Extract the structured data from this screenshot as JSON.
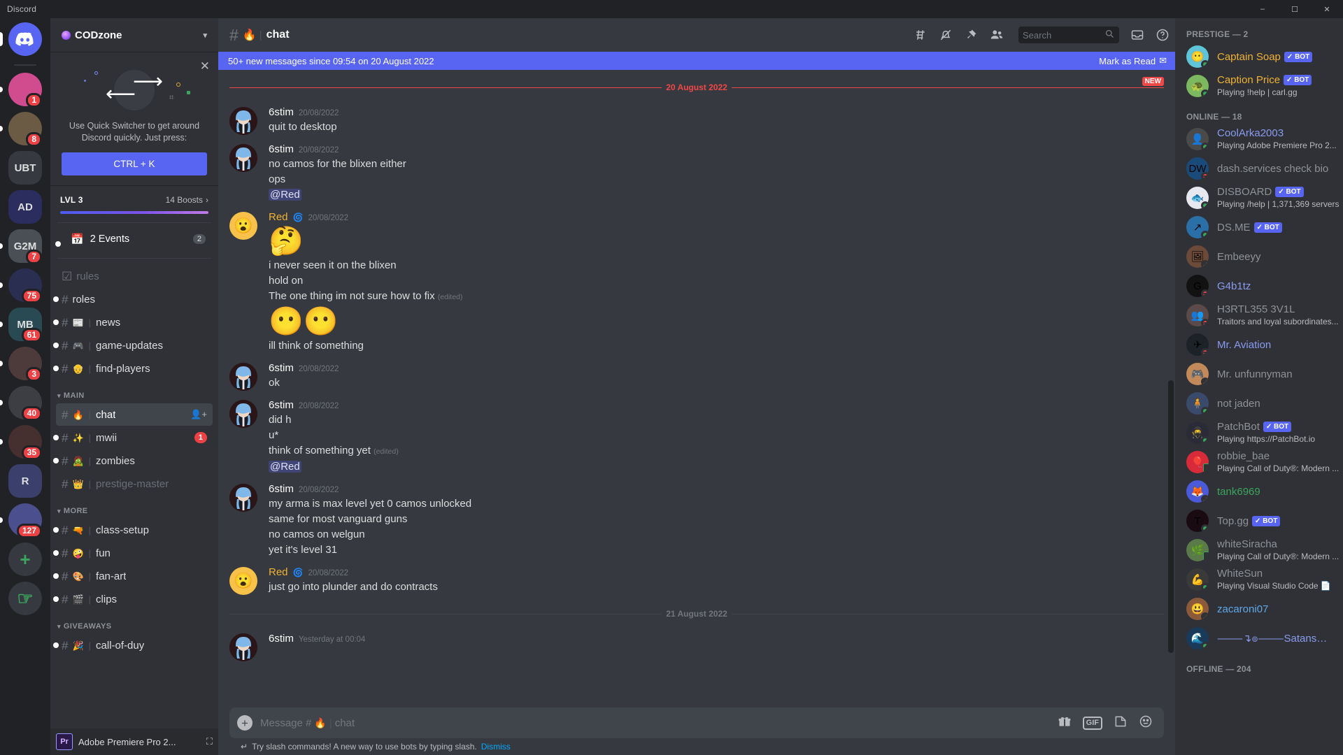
{
  "titlebar": {
    "app": "Discord",
    "minimize": "–",
    "maximize": "☐",
    "close": "✕"
  },
  "guilds": [
    {
      "name": "home",
      "label": "",
      "badge": "",
      "type": "home"
    },
    {
      "name": "guild-pink",
      "label": "",
      "badge": "1",
      "color": "#d14b8f"
    },
    {
      "name": "guild-sniper",
      "label": "",
      "badge": "8",
      "color": "#6b5a44"
    },
    {
      "name": "guild-ubt",
      "label": "UBT",
      "badge": "",
      "color": "#36393f"
    },
    {
      "name": "guild-ad",
      "label": "AD",
      "badge": "",
      "color": "#2b2d5e"
    },
    {
      "name": "guild-g2m",
      "label": "G2M",
      "badge": "7",
      "color": "#4a4f55"
    },
    {
      "name": "guild-75",
      "label": "",
      "badge": "75",
      "color": "#2a2f52"
    },
    {
      "name": "guild-mb",
      "label": "MB",
      "badge": "61",
      "color": "#294a52"
    },
    {
      "name": "guild-3",
      "label": "",
      "badge": "3",
      "color": "#4d3a3a"
    },
    {
      "name": "guild-40",
      "label": "",
      "badge": "40",
      "color": "#3d3d44"
    },
    {
      "name": "guild-35",
      "label": "",
      "badge": "35",
      "color": "#452f2f"
    },
    {
      "name": "guild-r",
      "label": "R",
      "badge": "",
      "color": "#3a3f6b"
    },
    {
      "name": "guild-127",
      "label": "",
      "badge": "127",
      "color": "#4b4f8e"
    }
  ],
  "sidebar": {
    "server_name": "CODzone",
    "quick_switcher": {
      "close": "✕",
      "text": "Use Quick Switcher to get around Discord quickly. Just press:",
      "button": "CTRL + K"
    },
    "boost": {
      "level": "LVL 3",
      "count": "14 Boosts",
      "chevron": "›"
    },
    "events": {
      "label": "2 Events",
      "badge": "2",
      "icon": "calendar-icon"
    },
    "channels": [
      {
        "name": "rules",
        "emoji": "",
        "hash": "☑",
        "muted": true,
        "unread": false,
        "dot": false
      },
      {
        "name": "roles",
        "emoji": "",
        "hash": "#",
        "muted": false,
        "unread": true,
        "dot": true
      },
      {
        "name": "news",
        "emoji": "📰",
        "hash": "#",
        "muted": false,
        "unread": true,
        "dot": true
      },
      {
        "name": "game-updates",
        "emoji": "🎮",
        "hash": "#",
        "muted": false,
        "unread": true,
        "dot": true
      },
      {
        "name": "find-players",
        "emoji": "👴",
        "hash": "#",
        "muted": false,
        "unread": true,
        "dot": true
      }
    ],
    "categories": [
      {
        "label": "MAIN",
        "channels": [
          {
            "name": "chat",
            "emoji": "🔥",
            "hash": "#",
            "active": true,
            "unread": true,
            "dot": false,
            "trailing": "add-member-icon"
          },
          {
            "name": "mwii",
            "emoji": "✨",
            "hash": "#",
            "unread": true,
            "dot": true,
            "badge": "1"
          },
          {
            "name": "zombies",
            "emoji": "🧟",
            "hash": "#",
            "unread": true,
            "dot": true
          },
          {
            "name": "prestige-master",
            "emoji": "👑",
            "hash": "#",
            "muted": true,
            "dot": false
          }
        ]
      },
      {
        "label": "MORE",
        "channels": [
          {
            "name": "class-setup",
            "emoji": "🔫",
            "hash": "#",
            "unread": true,
            "dot": true
          },
          {
            "name": "fun",
            "emoji": "🤪",
            "hash": "#",
            "unread": true,
            "dot": true
          },
          {
            "name": "fan-art",
            "emoji": "🎨",
            "hash": "#",
            "unread": true,
            "dot": true
          },
          {
            "name": "clips",
            "emoji": "🎬",
            "hash": "#",
            "unread": true,
            "dot": true
          }
        ]
      },
      {
        "label": "GIVEAWAYS",
        "channels": [
          {
            "name": "call-of-duy",
            "emoji": "🎉",
            "hash": "#",
            "unread": true,
            "dot": true
          }
        ]
      }
    ],
    "now_playing": {
      "icon": "Pr",
      "name": "Adobe Premiere Pro 2...",
      "screen_icon": "screenshare-icon"
    }
  },
  "header": {
    "hash": "#",
    "emoji": "🔥",
    "divider": "|",
    "channel": "chat",
    "icons": [
      "threads-icon",
      "notification-off-icon",
      "pin-icon",
      "members-icon"
    ],
    "search_placeholder": "Search",
    "search_icon": "search-icon",
    "inbox_icon": "inbox-icon",
    "help_icon": "help-icon"
  },
  "new_messages_bar": {
    "text": "50+ new messages since 09:54 on 20 August 2022",
    "mark_as_read": "Mark as Read",
    "mark_icon": "check-mail-icon"
  },
  "dividers": {
    "first": "20 August 2022",
    "new_tag": "NEW",
    "second": "21 August 2022"
  },
  "messages": [
    {
      "author": "6stim",
      "color": "white",
      "timestamp": "20/08/2022",
      "avatar": "6stim-avatar",
      "lines": [
        {
          "text": "quit to desktop"
        }
      ]
    },
    {
      "author": "6stim",
      "color": "white",
      "timestamp": "20/08/2022",
      "avatar": "6stim-avatar",
      "lines": [
        {
          "text": "no camos for the blixen either"
        },
        {
          "text": "ops"
        },
        {
          "text": "@Red",
          "mention": true
        }
      ]
    },
    {
      "author": "Red",
      "color": "red",
      "timestamp": "20/08/2022",
      "avatar": "red-avatar",
      "name_icon": "🌀",
      "lines": [
        {
          "emoji": "🤔",
          "big": true
        },
        {
          "text": "i never seen it on the blixen"
        },
        {
          "text": "hold on"
        },
        {
          "text": "The one thing im not sure how to fix",
          "edited": "(edited)"
        },
        {
          "emoji": "😶😶",
          "big": true
        },
        {
          "text": "ill think of something"
        }
      ]
    },
    {
      "author": "6stim",
      "color": "white",
      "timestamp": "20/08/2022",
      "avatar": "6stim-avatar",
      "lines": [
        {
          "text": "ok"
        }
      ]
    },
    {
      "author": "6stim",
      "color": "white",
      "timestamp": "20/08/2022",
      "avatar": "6stim-avatar",
      "lines": [
        {
          "text": "did h"
        },
        {
          "text": "u*"
        },
        {
          "text": "think of something yet",
          "edited": "(edited)"
        },
        {
          "text": "@Red",
          "mention": true
        }
      ]
    },
    {
      "author": "6stim",
      "color": "white",
      "timestamp": "20/08/2022",
      "avatar": "6stim-avatar",
      "lines": [
        {
          "text": "my arma is max level yet 0 camos unlocked"
        },
        {
          "text": "same for most vanguard guns"
        },
        {
          "text": "no camos on welgun"
        },
        {
          "text": "yet it's level 31"
        }
      ]
    },
    {
      "author": "Red",
      "color": "red",
      "timestamp": "20/08/2022",
      "avatar": "red-avatar",
      "name_icon": "🌀",
      "lines": [
        {
          "text": "just go into plunder and do contracts"
        }
      ]
    }
  ],
  "last_message": {
    "author": "6stim",
    "timestamp": "Yesterday at 00:04",
    "avatar": "6stim-avatar"
  },
  "composer": {
    "plus": "+",
    "placeholder_prefix": "Message #",
    "placeholder_emoji": "🔥",
    "placeholder_divider": "|",
    "placeholder_channel": "chat",
    "icons": [
      "gift-icon",
      "gif-icon",
      "sticker-icon",
      "emoji-icon"
    ],
    "gif_label": "GIF"
  },
  "tip": {
    "icon": "slash-icon",
    "text": "Try slash commands! A new way to use bots by typing slash.",
    "dismiss": "Dismiss"
  },
  "members": {
    "groups": [
      {
        "title": "PRESTIGE — 2",
        "items": [
          {
            "name": "Captain Soap",
            "color": "#f0b232",
            "bot": "BOT",
            "status": "online",
            "activity": "",
            "avatar_color": "#5fc4d8",
            "avatar_emoji": "😶"
          },
          {
            "name": "Caption Price",
            "color": "#f0b232",
            "bot": "BOT",
            "status": "online",
            "activity": "Playing !help | carl.gg",
            "activity_bold": "!help | carl.gg",
            "avatar_color": "#7bb85f",
            "avatar_emoji": "🐢"
          }
        ]
      },
      {
        "title": "ONLINE — 18",
        "items": [
          {
            "name": "CoolArka2003",
            "color": "#8a9bf0",
            "status": "online",
            "activity": "Playing Adobe Premiere Pro 2...",
            "avatar_color": "#4a4a4a",
            "avatar_emoji": "👤"
          },
          {
            "name": "dash.services check bio",
            "color": "#8e9297",
            "status": "dnd",
            "activity": "",
            "avatar_color": "#1a4a7a",
            "avatar_emoji": "DW"
          },
          {
            "name": "DISBOARD",
            "color": "#8e9297",
            "bot": "BOT",
            "status": "online",
            "activity": "Playing /help | 1,371,369 servers",
            "avatar_color": "#e8e8f0",
            "avatar_emoji": "🐟"
          },
          {
            "name": "DS.ME",
            "color": "#8e9297",
            "bot": "BOT",
            "status": "online",
            "activity": "",
            "avatar_color": "#2b6fa8",
            "avatar_emoji": "↗"
          },
          {
            "name": "Embeeyy",
            "color": "#8e9297",
            "status": "idle",
            "activity": "",
            "avatar_color": "#6b4a3a",
            "avatar_emoji": "🖼"
          },
          {
            "name": "G4b1tz",
            "color": "#8a9bf0",
            "status": "dnd",
            "activity": "",
            "avatar_color": "#121212",
            "avatar_emoji": "G"
          },
          {
            "name": "H3RTL355 3V1L",
            "color": "#8e9297",
            "status": "dnd",
            "activity": "Traitors and loyal subordinates...",
            "avatar_color": "#5a4a4a",
            "avatar_emoji": "👥"
          },
          {
            "name": "Mr. Aviation",
            "color": "#8a9bf0",
            "status": "dnd",
            "activity": "",
            "avatar_color": "#1c2228",
            "avatar_emoji": "✈"
          },
          {
            "name": "Mr. unfunnyman",
            "color": "#8e9297",
            "status": "idle",
            "activity": "",
            "avatar_color": "#c28a5a",
            "avatar_emoji": "🎮"
          },
          {
            "name": "not jaden",
            "color": "#8e9297",
            "status": "online",
            "activity": "",
            "avatar_color": "#3a4a6a",
            "avatar_emoji": "🧍"
          },
          {
            "name": "PatchBot",
            "color": "#8e9297",
            "bot": "BOT",
            "status": "online",
            "activity": "Playing https://PatchBot.io",
            "avatar_color": "#2b2b38",
            "avatar_emoji": "🥷"
          },
          {
            "name": "robbie_bae",
            "color": "#8e9297",
            "status": "mobile",
            "activity": "Playing Call of Duty®: Modern ...",
            "avatar_color": "#d82b3a",
            "avatar_emoji": "🎈"
          },
          {
            "name": "tank6969",
            "color": "#3ba55d",
            "status": "idle",
            "activity": "",
            "avatar_color": "#4a5ad8",
            "avatar_emoji": "🦊"
          },
          {
            "name": "Top.gg",
            "color": "#8e9297",
            "bot": "BOT",
            "status": "online",
            "activity": "",
            "avatar_color": "#1a0a12",
            "avatar_emoji": "T"
          },
          {
            "name": "whiteSiracha",
            "color": "#8e9297",
            "status": "mobile",
            "activity": "Playing Call of Duty®: Modern ...",
            "avatar_color": "#5a7a4a",
            "avatar_emoji": "🌿"
          },
          {
            "name": "WhiteSun",
            "color": "#8e9297",
            "status": "online",
            "activity": "Playing Visual Studio Code 📄",
            "avatar_color": "#3a3a3a",
            "avatar_emoji": "💪"
          },
          {
            "name": "zacaroni07",
            "color": "#5fa8e8",
            "status": "idle",
            "activity": "",
            "avatar_color": "#8a5a3a",
            "avatar_emoji": "😃"
          },
          {
            "name": "⸻↴๏⸻SatansLoli๏↴⸻",
            "color": "#8a9bf0",
            "status": "online",
            "activity": "",
            "avatar_color": "#1a3a5a",
            "avatar_emoji": "🌊"
          }
        ]
      },
      {
        "title": "OFFLINE — 204",
        "items": []
      }
    ]
  }
}
